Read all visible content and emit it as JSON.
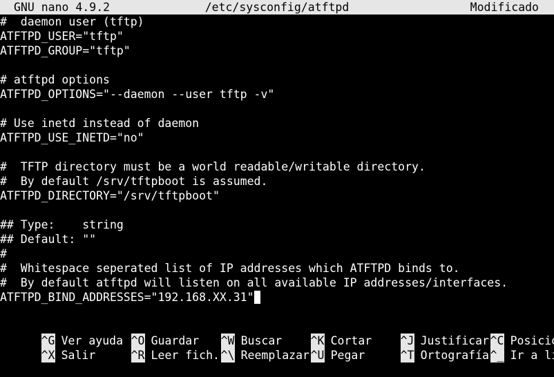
{
  "titlebar": {
    "app": "GNU nano 4.9.2",
    "file": "/etc/sysconfig/atftpd",
    "status": "Modificado"
  },
  "editor": {
    "lines": [
      "#  daemon user (tftp)",
      "ATFTPD_USER=\"tftp\"",
      "ATFTPD_GROUP=\"tftp\"",
      "",
      "# atftpd options",
      "ATFTPD_OPTIONS=\"--daemon --user tftp -v\"",
      "",
      "# Use inetd instead of daemon",
      "ATFTPD_USE_INETD=\"no\"",
      "",
      "#  TFTP directory must be a world readable/writable directory.",
      "#  By default /srv/tftpboot is assumed.",
      "ATFTPD_DIRECTORY=\"/srv/tftpboot\"",
      "",
      "## Type:    string",
      "## Default: \"\"",
      "#",
      "#  Whitespace seperated list of IP addresses which ATFTPD binds to.",
      "#  By default atftpd will listen on all available IP addresses/interfaces.",
      "ATFTPD_BIND_ADDRESSES=\"192.168.XX.31\""
    ]
  },
  "shortcuts": {
    "row1": [
      {
        "key": "^G",
        "label": "Ver ayuda"
      },
      {
        "key": "^O",
        "label": "Guardar"
      },
      {
        "key": "^W",
        "label": "Buscar"
      },
      {
        "key": "^K",
        "label": "Cortar"
      },
      {
        "key": "^J",
        "label": "Justificar"
      },
      {
        "key": "^C",
        "label": "Posición"
      }
    ],
    "row2": [
      {
        "key": "^X",
        "label": "Salir"
      },
      {
        "key": "^R",
        "label": "Leer fich."
      },
      {
        "key": "^\\",
        "label": "Reemplazar"
      },
      {
        "key": "^U",
        "label": "Pegar"
      },
      {
        "key": "^T",
        "label": "Ortografía"
      },
      {
        "key": "^_",
        "label": "Ir a línea"
      }
    ]
  },
  "colors": {
    "background": "#000000",
    "text": "#ffffff",
    "bar": "#e6e6e6",
    "bar_text": "#000000"
  }
}
